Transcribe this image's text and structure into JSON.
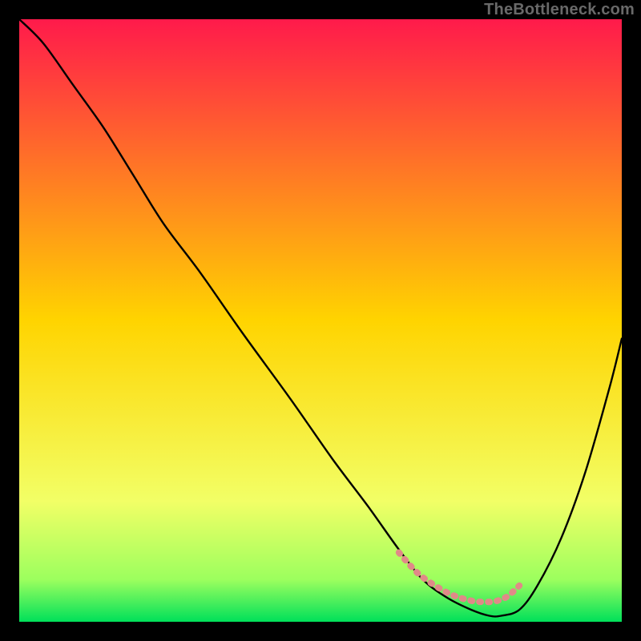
{
  "branding": {
    "text": "TheBottleneck.com"
  },
  "chart_data": {
    "type": "line",
    "title": "",
    "xlabel": "",
    "ylabel": "",
    "x_range": [
      0,
      100
    ],
    "y_range": [
      0,
      100
    ],
    "grid": false,
    "legend": false,
    "background_gradient": {
      "stops": [
        {
          "pos": 0.0,
          "color": "#ff1a4b"
        },
        {
          "pos": 0.5,
          "color": "#ffd400"
        },
        {
          "pos": 0.8,
          "color": "#f2ff66"
        },
        {
          "pos": 0.93,
          "color": "#9cff5e"
        },
        {
          "pos": 1.0,
          "color": "#00e05a"
        }
      ]
    },
    "series": [
      {
        "name": "curve",
        "color": "#000000",
        "x": [
          0,
          4,
          9,
          14,
          19,
          24,
          30,
          37,
          45,
          52,
          58,
          63,
          67,
          71,
          75,
          78,
          80,
          83,
          86,
          90,
          94,
          98,
          100
        ],
        "y": [
          100,
          96,
          89,
          82,
          74,
          66,
          58,
          48,
          37,
          27,
          19,
          12,
          7,
          4,
          2,
          1,
          1,
          2,
          6,
          14,
          25,
          39,
          47
        ]
      }
    ],
    "highlight_band": {
      "name": "flat-zone",
      "color": "#e08a88",
      "x": [
        63,
        66,
        69,
        72,
        75,
        77,
        79,
        81,
        83
      ],
      "y": [
        11.5,
        8.2,
        6.0,
        4.4,
        3.5,
        3.3,
        3.4,
        4.2,
        6.0
      ]
    }
  }
}
